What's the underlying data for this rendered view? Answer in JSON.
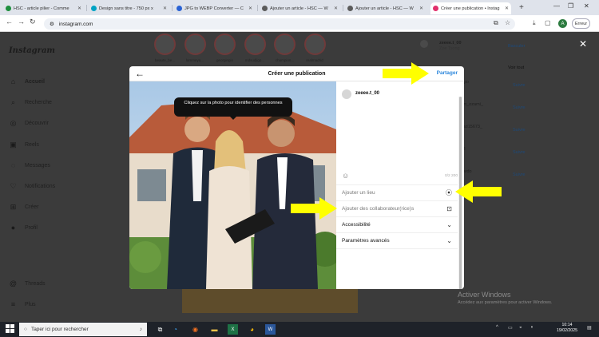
{
  "browser": {
    "tabs": [
      {
        "label": "HSC - article pilier - Comme",
        "color": "#1e8e3e",
        "active": false
      },
      {
        "label": "Design sans titre - 750 px x",
        "color": "#00a3c4",
        "active": false
      },
      {
        "label": "JPG to WEBP Converter — C",
        "color": "#2a62d4",
        "active": false
      },
      {
        "label": "Ajouter un article - HSC — W",
        "color": "#5b5b5b",
        "active": false
      },
      {
        "label": "Ajouter un article - HSC — W",
        "color": "#5b5b5b",
        "active": false
      },
      {
        "label": "Créer une publication • Instag",
        "color": "#e1306c",
        "active": true
      }
    ],
    "new_tab": "+",
    "url": "instagram.com",
    "profile_initial": "A",
    "relaunch_label": "Erreur"
  },
  "instagram": {
    "logo": "Instagram",
    "nav": [
      {
        "label": "Accueil",
        "icon": "home-icon",
        "glyph": "⌂"
      },
      {
        "label": "Recherche",
        "icon": "search-icon",
        "glyph": "⌕"
      },
      {
        "label": "Découvrir",
        "icon": "compass-icon",
        "glyph": "◎"
      },
      {
        "label": "Reels",
        "icon": "reels-icon",
        "glyph": "▣"
      },
      {
        "label": "Messages",
        "icon": "messenger-icon",
        "glyph": "◌"
      },
      {
        "label": "Notifications",
        "icon": "heart-icon",
        "glyph": "♡"
      },
      {
        "label": "Créer",
        "icon": "create-icon",
        "glyph": "⊞"
      },
      {
        "label": "Profil",
        "icon": "profile-icon",
        "glyph": "●"
      }
    ],
    "nav_bottom": [
      {
        "label": "Threads",
        "icon": "threads-icon",
        "glyph": "@"
      },
      {
        "label": "Plus",
        "icon": "menu-icon",
        "glyph": "≡"
      }
    ],
    "stories": [
      "beaute_be...",
      "lammeya...",
      "georgingio",
      "mdsudjigo...",
      "champion...",
      "realmadrid"
    ],
    "suggestions": {
      "username": "zeeee.t_00",
      "subname": "Zoe Tsong",
      "switch": "Basculer",
      "see_all": "Voir tout",
      "follow": "Suivre",
      "suggested": [
        {
          "name": "...gio",
          "follow": "Suivre"
        },
        {
          "name": "...m_ozami_",
          "follow": "Suivre"
        },
        {
          "name": "...ad15673_",
          "follow": "Suivre"
        },
        {
          "name": "...3",
          "follow": "Suivre"
        },
        {
          "name": "...ardo",
          "follow": "Suivre"
        }
      ]
    }
  },
  "modal": {
    "title": "Créer une publication",
    "share": "Partager",
    "tooltip": "Cliquez sur la photo pour identifier des personnes",
    "username": "zeeee.t_00",
    "counter": "0/2 200",
    "rows": [
      {
        "label": "Ajouter un lieu",
        "icon": "location-pin-icon",
        "glyph": "⦿"
      },
      {
        "label": "Ajouter des collaborateur(rice)s",
        "icon": "collaborator-icon",
        "glyph": "⊡"
      },
      {
        "label": "Accessibilité",
        "icon": "chevron-down-icon",
        "glyph": "⌄"
      },
      {
        "label": "Paramètres avancés",
        "icon": "chevron-down-icon",
        "glyph": "⌄"
      }
    ]
  },
  "watermark": {
    "title": "Activer Windows",
    "subtitle": "Accédez aux paramètres pour activer Windows."
  },
  "taskbar": {
    "search_placeholder": "Taper ici pour rechercher",
    "time": "10:14",
    "date": "19/02/2025"
  },
  "colors": {
    "accent": "#2e88dc",
    "arrow": "#ffff00",
    "overlay": "#3b3b3b"
  }
}
